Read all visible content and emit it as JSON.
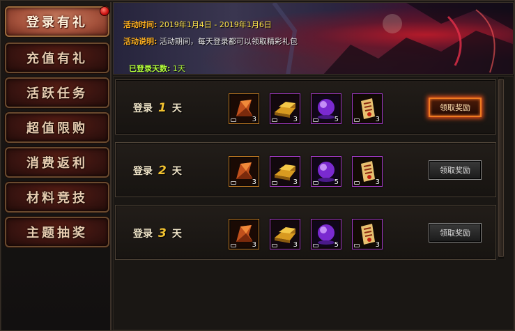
{
  "sidebar": {
    "items": [
      {
        "label": "登录有礼",
        "active": true
      },
      {
        "label": "充值有礼",
        "active": false
      },
      {
        "label": "活跃任务",
        "active": false
      },
      {
        "label": "超值限购",
        "active": false
      },
      {
        "label": "消费返利",
        "active": false
      },
      {
        "label": "材料竞技",
        "active": false
      },
      {
        "label": "主题抽奖",
        "active": false
      }
    ]
  },
  "banner": {
    "time_label": "活动时间:",
    "time_value": "2019年1月4日 - 2019年1月6日",
    "desc_label": "活动说明:",
    "desc_value": "活动期间，每天登录都可以领取精彩礼包",
    "days_label": "已登录天数:",
    "days_value": "1天"
  },
  "rows": [
    {
      "prefix": "登录",
      "day": "1",
      "suffix": "天",
      "button": "领取奖励",
      "claimable": true,
      "items": [
        {
          "icon": "orange-shard-icon",
          "qty": "3"
        },
        {
          "icon": "gold-bar-icon",
          "qty": "3"
        },
        {
          "icon": "purple-orb-icon",
          "qty": "5"
        },
        {
          "icon": "talisman-scroll-icon",
          "qty": "3"
        }
      ]
    },
    {
      "prefix": "登录",
      "day": "2",
      "suffix": "天",
      "button": "领取奖励",
      "claimable": false,
      "items": [
        {
          "icon": "orange-shard-icon",
          "qty": "3"
        },
        {
          "icon": "gold-bar-icon",
          "qty": "3"
        },
        {
          "icon": "purple-orb-icon",
          "qty": "5"
        },
        {
          "icon": "talisman-scroll-icon",
          "qty": "3"
        }
      ]
    },
    {
      "prefix": "登录",
      "day": "3",
      "suffix": "天",
      "button": "领取奖励",
      "claimable": false,
      "items": [
        {
          "icon": "orange-shard-icon",
          "qty": "3"
        },
        {
          "icon": "gold-bar-icon",
          "qty": "3"
        },
        {
          "icon": "purple-orb-icon",
          "qty": "5"
        },
        {
          "icon": "talisman-scroll-icon",
          "qty": "3"
        }
      ]
    }
  ],
  "colors": {
    "label_orange": "#ffb020",
    "time_yellow": "#ffe44a",
    "days_green": "#b4ff3a",
    "day_number_gold": "#f2c230",
    "active_tab": "#a5523c",
    "button_glow": "#e8501a"
  }
}
